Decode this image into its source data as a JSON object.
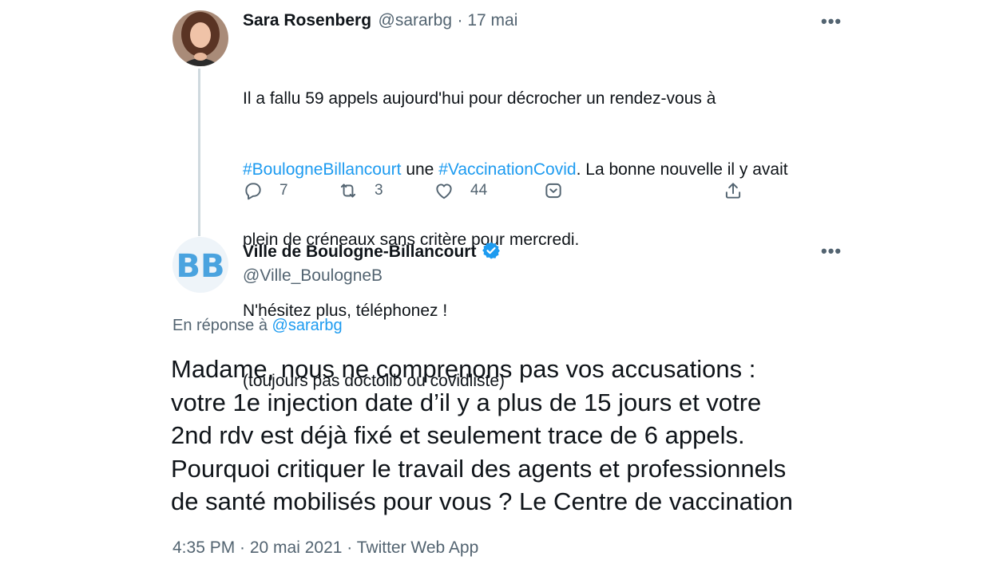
{
  "parent_tweet": {
    "author_name": "Sara Rosenberg",
    "author_handle": "@sararbg",
    "date": "· 17 mai",
    "more_label": "•••",
    "text_parts": {
      "line1": "Il a fallu 59 appels aujourd'hui pour décrocher un rendez-vous à",
      "hashtag1": "#BoulogneBillancourt",
      "between": " une ",
      "hashtag2": "#VaccinationCovid",
      "after": ". La bonne nouvelle il y avait",
      "line3": "plein de créneaux sans critère pour mercredi.",
      "line4": "N'hésitez plus, téléphonez !",
      "line5": "(toujours pas doctolib ou covidliste)"
    },
    "actions": {
      "reply_count": "7",
      "retweet_count": "3",
      "like_count": "44"
    }
  },
  "main_tweet": {
    "author_name": "Ville de Boulogne-Billancourt",
    "author_handle": "@Ville_BoulogneB",
    "avatar_text": "BB",
    "more_label": "•••",
    "reply_prefix": "En réponse à ",
    "reply_mention": "@sararbg",
    "text": "Madame, nous ne comprenons pas vos accusations :\nvotre 1e injection date d’il y a plus de 15 jours et votre\n2nd rdv est déjà fixé et seulement trace de 6 appels.\nPourquoi critiquer le travail des agents et professionnels\nde santé mobilisés pour vous ? Le Centre de vaccination",
    "meta": "4:35 PM · 20 mai 2021 · Twitter Web App"
  },
  "colors": {
    "accent": "#1d9bf0",
    "secondary_text": "#536471",
    "primary_text": "#0f1419",
    "avatar_bb": "#4aa3df"
  }
}
